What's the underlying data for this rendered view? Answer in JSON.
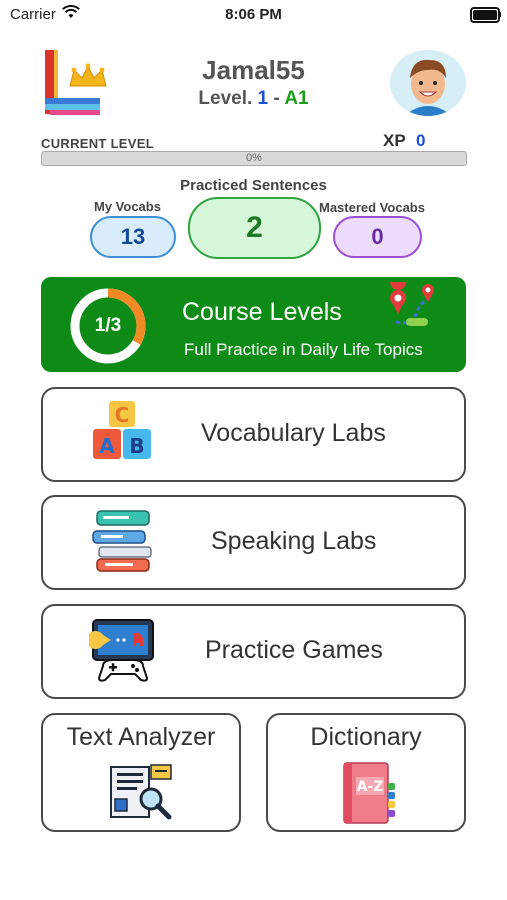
{
  "status_bar": {
    "carrier": "Carrier",
    "time": "8:06 PM"
  },
  "profile": {
    "username": "Jamal55",
    "level_prefix": "Level.",
    "level_number": "1",
    "level_separator": "-",
    "level_cefr": "A1"
  },
  "progress": {
    "label": "CURRENT LEVEL",
    "xp_label": "XP",
    "xp_value": "0",
    "percent_text": "0%",
    "fraction": 0
  },
  "stats": {
    "title": "Practiced Sentences",
    "practiced": "2",
    "my_vocabs_label": "My Vocabs",
    "my_vocabs": "13",
    "mastered_label": "Mastered Vocabs",
    "mastered": "0"
  },
  "course": {
    "title": "Course Levels",
    "subtitle": "Full Practice in Daily Life Topics",
    "progress_text": "1/3",
    "fraction": 0.333
  },
  "menu": {
    "vocabulary": "Vocabulary Labs",
    "speaking": "Speaking Labs",
    "games": "Practice Games",
    "text_analyzer": "Text Analyzer",
    "dictionary": "Dictionary"
  },
  "colors": {
    "brand_green": "#0e8b16",
    "level_blue": "#1a4fd6",
    "level_green": "#1a9e1a"
  },
  "icons": [
    "wifi-icon",
    "battery-icon",
    "books-crown-logo",
    "avatar",
    "map-route-icon",
    "abc-blocks-icon",
    "chat-bubbles-icon",
    "game-screen-icon",
    "document-magnifier-icon",
    "az-book-icon"
  ]
}
